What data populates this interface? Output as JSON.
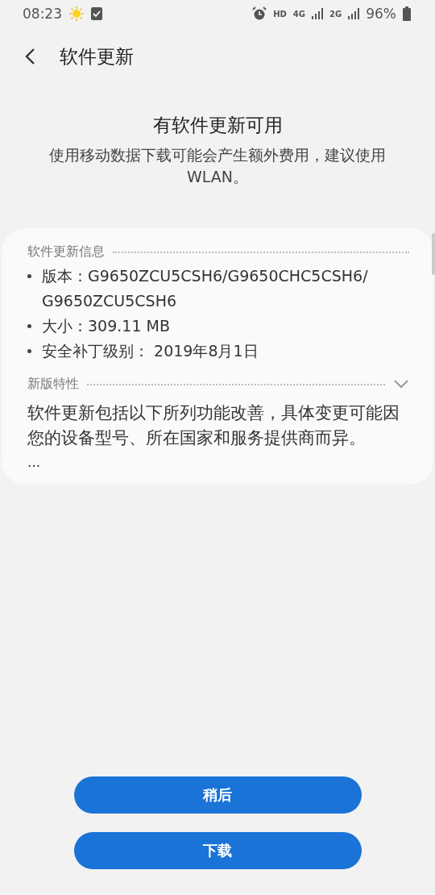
{
  "status_bar": {
    "time": "08:23",
    "network_label": "HD",
    "mobile_1": "4G",
    "mobile_2": "2G",
    "battery": "96%"
  },
  "header": {
    "title": "软件更新"
  },
  "notice": {
    "title": "有软件更新可用",
    "message": "使用移动数据下载可能会产生额外费用，建议使用 WLAN。"
  },
  "info": {
    "heading": "软件更新信息",
    "items": [
      "版本：G9650ZCU5CSH6/G9650CHC5CSH6/ G9650ZCU5CSH6",
      "大小：309.11 MB",
      "安全补丁级别： 2019年8月1日"
    ]
  },
  "features": {
    "heading": "新版特性",
    "expanded": false,
    "text": "软件更新包括以下所列功能改善，具体变更可能因您的设备型号、所在国家和服务提供商而异。",
    "more": "..."
  },
  "buttons": [
    "稍后",
    "下载"
  ]
}
